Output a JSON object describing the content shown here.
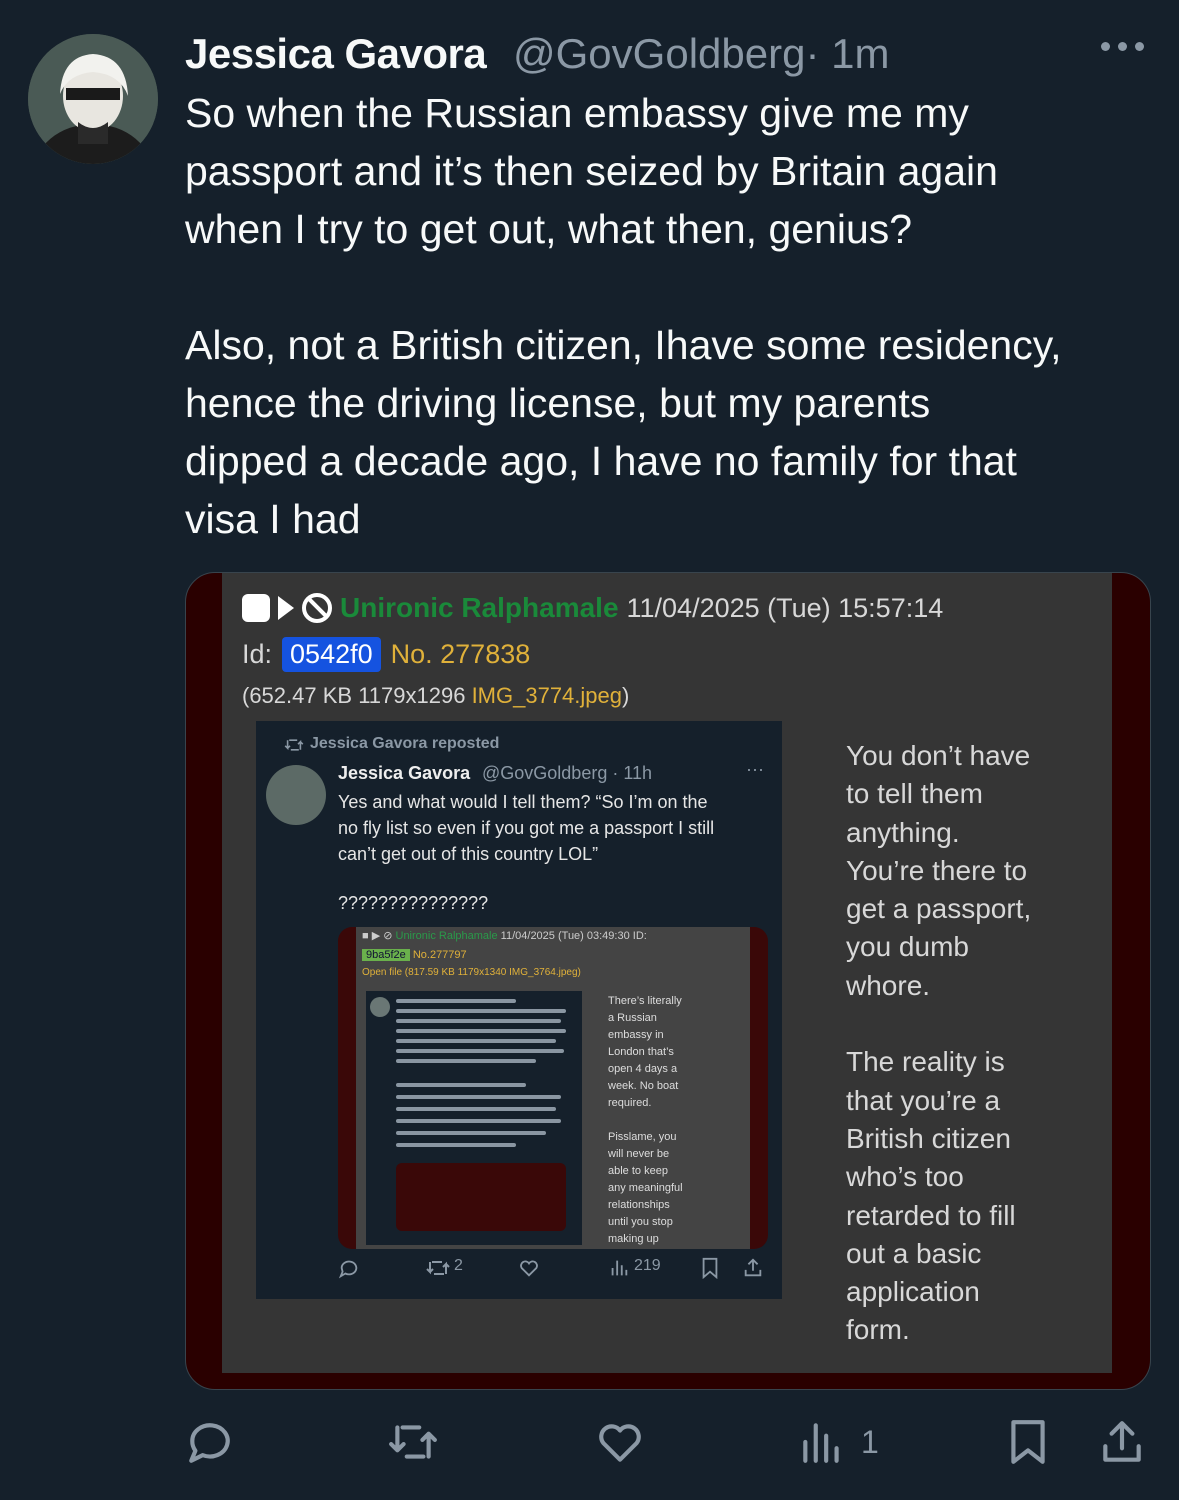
{
  "tweet": {
    "author_name": "Jessica Gavora",
    "author_handle": "@GovGoldberg",
    "time": "· 1m",
    "text": "So when the Russian embassy give me my\npassport and it’s then seized by Britain again\nwhen I try to get out, what then, genius?\n\nAlso, not a British citizen, Ihave some residency,\nhence the driving license, but my parents\ndipped a decade ago, I have no family for that\nvisa I had",
    "views_count": "1"
  },
  "media_post": {
    "poster_name": "Unironic Ralphamale",
    "datetime": "11/04/2025 (Tue) 15:57:14",
    "id_label": "Id:",
    "id_value": "0542f0",
    "post_number": "No. 277838",
    "file_info_prefix": "(652.47 KB 1179x1296 ",
    "file_name": "IMG_3774.jpeg",
    "file_info_suffix": ")",
    "reply_text": "You don’t have\nto tell them\nanything.\nYou’re there to\nget a passport,\nyou dumb\nwhore.\n\nThe reality is\nthat you’re a\nBritish citizen\nwho’s too\nretarded to fill\nout a basic\napplication\nform."
  },
  "embedded_tweet": {
    "reposted_label": "Jessica Gavora reposted",
    "author_name": "Jessica Gavora",
    "author_handle": "@GovGoldberg · 11h",
    "more": "···",
    "text": "Yes and what would I tell them? “So I’m on the\nno fly list so even if you got me a passport I still\ncan’t get out of this country LOL”",
    "question_marks": "???????????????",
    "retweets": "2",
    "views": "219"
  },
  "nested_post": {
    "poster_name": "Unironic Ralphamale",
    "datetime": "11/04/2025 (Tue) 03:49:30 ID:",
    "id_value": "9ba5f2e",
    "post_number": "No.277797",
    "file_info": "Open file (817.59 KB 1179x1340 IMG_3764.jpeg)",
    "reply_text": "There’s literally\na Russian\nembassy in\nLondon that’s\nopen 4 days a\nweek. No boat\nrequired.\n\nPisslame, you\nwill never be\nable to keep\nany meaningful\nrelationships\nuntil you stop\nmaking up"
  },
  "colors": {
    "background": "#15202b",
    "text_primary": "#f7f9f9",
    "text_secondary": "#8b98a5",
    "poster_green": "#1a8a3a",
    "post_number_gold": "#e0b13a",
    "id_blue": "#1553e0"
  },
  "icons": [
    "more-icon",
    "reply-icon",
    "retweet-icon",
    "like-icon",
    "views-icon",
    "bookmark-icon",
    "share-icon"
  ]
}
